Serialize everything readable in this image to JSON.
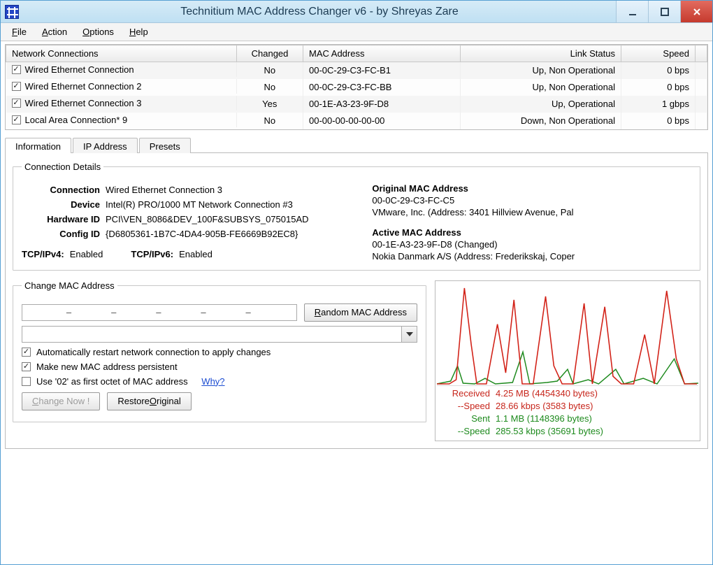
{
  "window": {
    "title": "Technitium MAC Address Changer v6 - by Shreyas Zare"
  },
  "menu": {
    "file": "File",
    "action": "Action",
    "options": "Options",
    "help": "Help"
  },
  "table": {
    "cols": {
      "name": "Network Connections",
      "changed": "Changed",
      "mac": "MAC Address",
      "link": "Link Status",
      "speed": "Speed"
    },
    "rows": [
      {
        "checked": true,
        "name": "Wired Ethernet Connection",
        "changed": "No",
        "mac": "00-0C-29-C3-FC-B1",
        "link": "Up, Non Operational",
        "speed": "0 bps"
      },
      {
        "checked": true,
        "name": "Wired Ethernet Connection 2",
        "changed": "No",
        "mac": "00-0C-29-C3-FC-BB",
        "link": "Up, Non Operational",
        "speed": "0 bps"
      },
      {
        "checked": true,
        "name": "Wired Ethernet Connection 3",
        "changed": "Yes",
        "mac": "00-1E-A3-23-9F-D8",
        "link": "Up, Operational",
        "speed": "1 gbps"
      },
      {
        "checked": true,
        "name": "Local Area Connection* 9",
        "changed": "No",
        "mac": "00-00-00-00-00-00",
        "link": "Down, Non Operational",
        "speed": "0 bps"
      }
    ]
  },
  "tabs": {
    "information": "Information",
    "ip": "IP Address",
    "presets": "Presets"
  },
  "details": {
    "legend": "Connection Details",
    "labels": {
      "connection": "Connection",
      "device": "Device",
      "hwid": "Hardware ID",
      "cfgid": "Config ID",
      "ipv4": "TCP/IPv4:",
      "ipv6": "TCP/IPv6:"
    },
    "values": {
      "connection": "Wired Ethernet Connection 3",
      "device": "Intel(R) PRO/1000 MT Network Connection #3",
      "hwid": "PCI\\VEN_8086&DEV_100F&SUBSYS_075015AD",
      "cfgid": "{D6805361-1B7C-4DA4-905B-FE6669B92EC8}",
      "ipv4": "Enabled",
      "ipv6": "Enabled"
    },
    "right": {
      "orig_head": "Original MAC Address",
      "orig_mac": "00-0C-29-C3-FC-C5",
      "orig_vendor": "VMware, Inc.  (Address: 3401 Hillview Avenue, Pal",
      "active_head": "Active MAC Address",
      "active_mac": "00-1E-A3-23-9F-D8 (Changed)",
      "active_vendor": "Nokia Danmark A/S  (Address: Frederikskaj, Coper"
    }
  },
  "change": {
    "legend": "Change MAC Address",
    "random_btn": "Random MAC Address",
    "opt_restart": "Automatically restart network connection to apply changes",
    "opt_persist": "Make new MAC address persistent",
    "opt_first02": "Use '02' as first octet of MAC address",
    "why": "Why?",
    "change_btn": "Change Now !",
    "restore_btn": "Restore Original"
  },
  "stats": {
    "recv_label": "Received",
    "recv_val": "4.25 MB (4454340 bytes)",
    "recv_speed_label": "--Speed",
    "recv_speed_val": "28.66 kbps (3583 bytes)",
    "sent_label": "Sent",
    "sent_val": "1.1 MB (1148396 bytes)",
    "sent_speed_label": "--Speed",
    "sent_speed_val": "285.53 kbps (35691 bytes)"
  }
}
